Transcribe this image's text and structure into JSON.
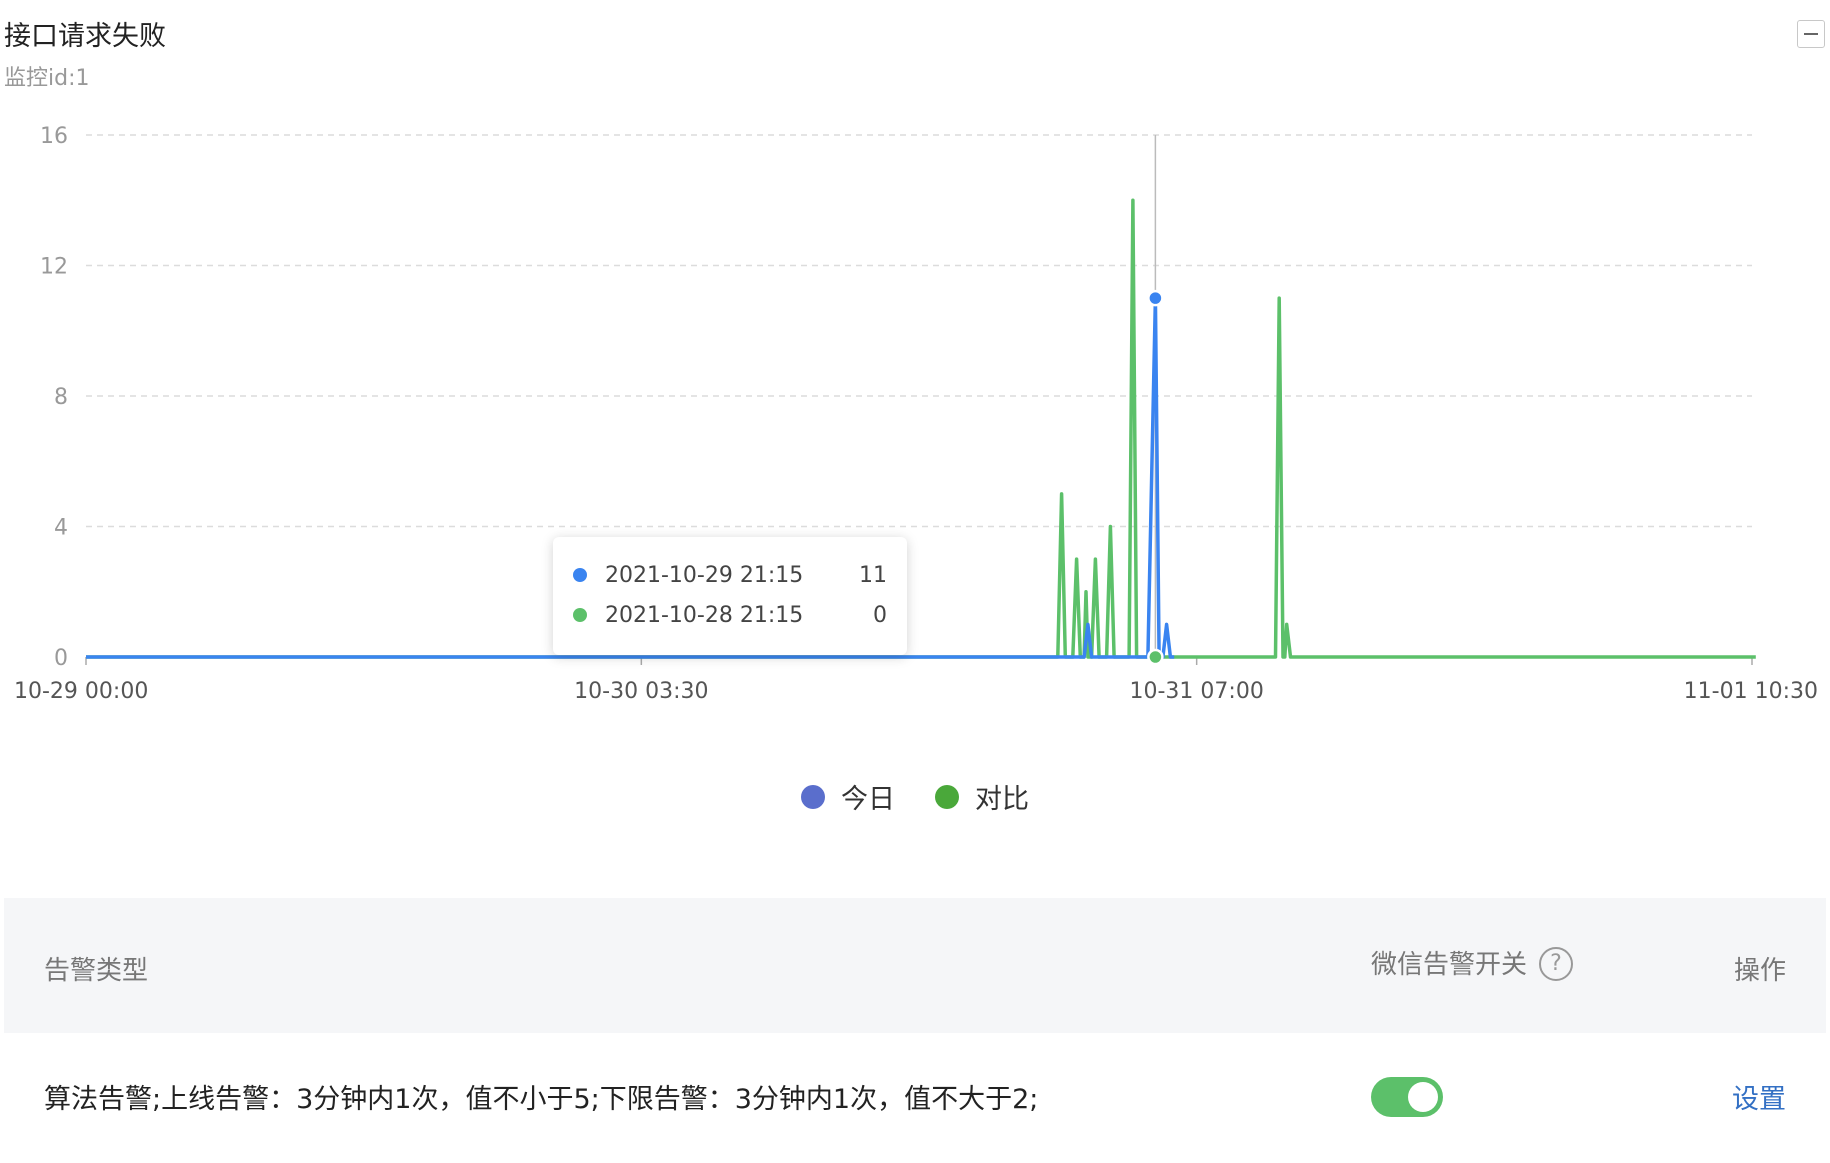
{
  "panel": {
    "title": "接口请求失败",
    "subtitle": "监控id:1"
  },
  "chart_data": {
    "type": "line",
    "x_labels": [
      "10-29 00:00",
      "10-30 03:30",
      "10-31 07:00",
      "11-01 10:30"
    ],
    "y_ticks": [
      0,
      4,
      8,
      12,
      16
    ],
    "ylim": [
      0,
      16
    ],
    "grid": true,
    "legend_position": "bottom-center",
    "series": [
      {
        "name": "今日",
        "color": "#3a84f0",
        "points": [
          [
            0,
            0
          ],
          [
            266,
            0
          ],
          [
            267,
            1
          ],
          [
            268,
            0
          ],
          [
            283,
            0
          ],
          [
            285,
            11
          ],
          [
            286,
            0
          ],
          [
            287,
            0
          ],
          [
            288,
            1
          ],
          [
            289,
            0
          ],
          [
            290,
            0
          ]
        ]
      },
      {
        "name": "对比",
        "color": "#5cc06a",
        "points": [
          [
            0,
            0
          ],
          [
            259,
            0
          ],
          [
            260,
            5
          ],
          [
            261,
            0
          ],
          [
            263,
            0
          ],
          [
            264,
            3
          ],
          [
            265,
            0
          ],
          [
            266,
            0
          ],
          [
            266.5,
            2
          ],
          [
            267,
            0
          ],
          [
            268,
            0
          ],
          [
            269,
            3
          ],
          [
            270,
            0
          ],
          [
            272,
            0
          ],
          [
            273,
            4
          ],
          [
            274,
            0
          ],
          [
            278,
            0
          ],
          [
            279,
            14
          ],
          [
            280,
            0
          ],
          [
            317,
            0
          ],
          [
            318,
            11
          ],
          [
            319,
            0
          ],
          [
            319.5,
            0
          ],
          [
            320,
            1
          ],
          [
            321,
            0
          ],
          [
            445,
            0
          ]
        ]
      }
    ],
    "hover": {
      "x": 285
    }
  },
  "tooltip": {
    "rows": [
      {
        "label": "2021-10-29 21:15",
        "value": "11",
        "color": "#3a84f0"
      },
      {
        "label": "2021-10-28 21:15",
        "value": "0",
        "color": "#5cc06a"
      }
    ]
  },
  "legend": [
    {
      "label": "今日",
      "color": "#5a6ecc"
    },
    {
      "label": "对比",
      "color": "#4aa83a"
    }
  ],
  "table": {
    "headers": {
      "type": "告警类型",
      "wechat": "微信告警开关",
      "action": "操作"
    },
    "rows": [
      {
        "desc": "算法告警;上线告警：3分钟内1次，值不小于5;下限告警：3分钟内1次，值不大于2;",
        "enabled": true,
        "action": "设置"
      }
    ]
  }
}
